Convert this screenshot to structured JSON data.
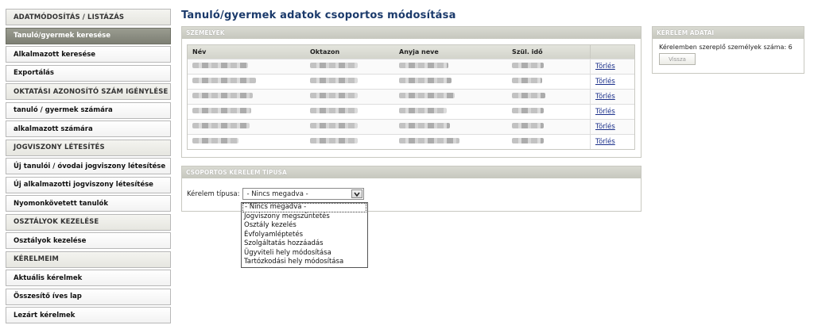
{
  "sidebar": {
    "items": [
      {
        "label": "ADATMÓDOSÍTÁS / LISTÁZÁS",
        "type": "header"
      },
      {
        "label": "Tanuló/gyermek keresése",
        "type": "active"
      },
      {
        "label": "Alkalmazott keresése",
        "type": "link"
      },
      {
        "label": "Exportálás",
        "type": "link"
      },
      {
        "label": "OKTATÁSI AZONOSÍTÓ SZÁM IGÉNYLÉSE",
        "type": "header"
      },
      {
        "label": "tanuló / gyermek számára",
        "type": "link"
      },
      {
        "label": "alkalmazott számára",
        "type": "link"
      },
      {
        "label": "JOGVISZONY LÉTESÍTÉS",
        "type": "header"
      },
      {
        "label": "Új tanulói / óvodai jogviszony létesítése",
        "type": "link"
      },
      {
        "label": "Új alkalmazotti jogviszony létesítése",
        "type": "link"
      },
      {
        "label": "Nyomonkövetett tanulók",
        "type": "link"
      },
      {
        "label": "OSZTÁLYOK KEZELÉSE",
        "type": "header"
      },
      {
        "label": "Osztályok kezelése",
        "type": "link"
      },
      {
        "label": "KÉRELMEIM",
        "type": "header"
      },
      {
        "label": "Aktuális kérelmek",
        "type": "link"
      },
      {
        "label": "Összesítő íves lap",
        "type": "link"
      },
      {
        "label": "Lezárt kérelmek",
        "type": "link"
      }
    ]
  },
  "page_title": "Tanuló/gyermek adatok csoportos módosítása",
  "persons_panel": {
    "title": "SZEMÉLYEK",
    "columns": [
      "Név",
      "Oktazon",
      "Anyja neve",
      "Szül. idő",
      ""
    ],
    "row_action": "Törlés",
    "row_count": 6
  },
  "request_panel": {
    "title": "KÉRELEM ADATAI",
    "count_text": "Kérelemben szereplő személyek száma: 6",
    "back_button": "Vissza"
  },
  "type_panel": {
    "title": "CSOPORTOS KÉRELEM TÍPUSA",
    "label": "Kérelem típusa:",
    "selected": "- Nincs megadva -",
    "options": [
      "- Nincs megadva -",
      "Jogviszony megszüntetés",
      "Osztály kezelés",
      "Évfolyamléptetés",
      "Szolgáltatás hozzáadás",
      "Ügyviteli hely módosítása",
      "Tartózkodási hely módosítása"
    ]
  },
  "icons": {
    "dropdown_arrow": "chevron-down-icon"
  }
}
